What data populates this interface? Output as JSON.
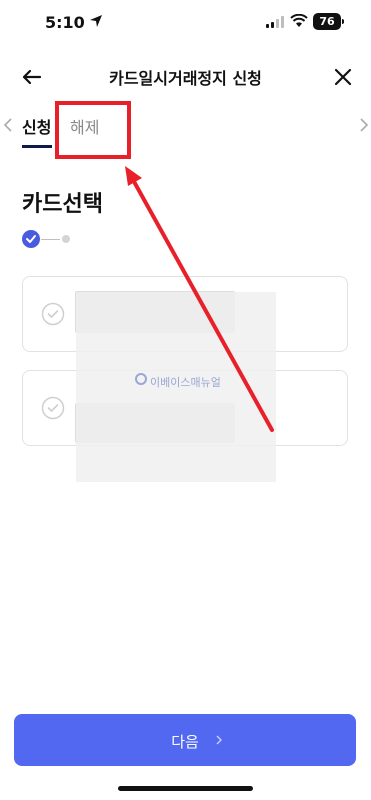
{
  "status_bar": {
    "time": "5:10",
    "battery": "76"
  },
  "header": {
    "title": "카드일시거래정지 신청",
    "back_icon": "arrow-left-icon",
    "close_icon": "close-icon"
  },
  "tabs": [
    {
      "label": "신청",
      "active": true
    },
    {
      "label": "해제",
      "active": false
    }
  ],
  "section": {
    "title": "카드선택"
  },
  "steps": {
    "current": 1,
    "total": 2
  },
  "cards": [
    {
      "selected": false
    },
    {
      "selected": false
    }
  ],
  "watermark": "이베이스매뉴얼",
  "footer": {
    "next_label": "다음"
  },
  "colors": {
    "accent": "#5268f0",
    "highlight": "#e8202a",
    "step_done": "#4a5be0"
  }
}
